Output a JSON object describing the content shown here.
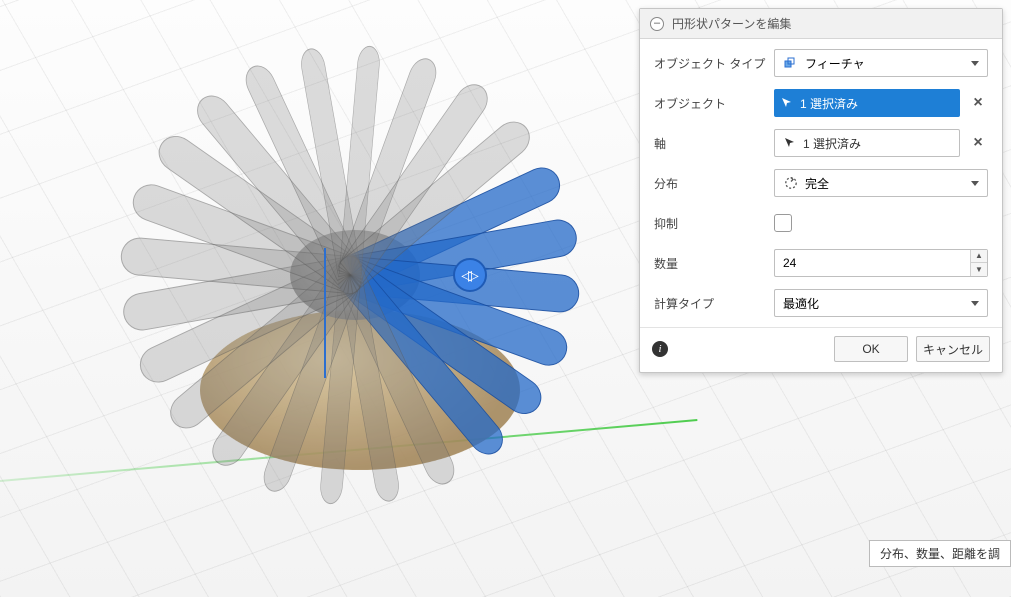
{
  "dialog": {
    "title": "円形状パターンを編集",
    "rows": {
      "object_type": {
        "label": "オブジェクト タイプ",
        "value": "フィーチャ"
      },
      "objects": {
        "label": "オブジェクト",
        "value": "1 選択済み"
      },
      "axis": {
        "label": "軸",
        "value": "1 選択済み"
      },
      "distribution": {
        "label": "分布",
        "value": "完全"
      },
      "suppress": {
        "label": "抑制",
        "checked": false
      },
      "quantity": {
        "label": "数量",
        "value": "24"
      },
      "compute": {
        "label": "計算タイプ",
        "value": "最適化"
      }
    },
    "buttons": {
      "ok": "OK",
      "cancel": "キャンセル"
    }
  },
  "hint_text": "分布、数量、距離を調",
  "manipulator": {
    "glyph_left": "◁",
    "glyph_right": "▷"
  },
  "viewport": {
    "blade_count": 24,
    "selected_blades": [
      0,
      1,
      2,
      3,
      4,
      5
    ]
  }
}
